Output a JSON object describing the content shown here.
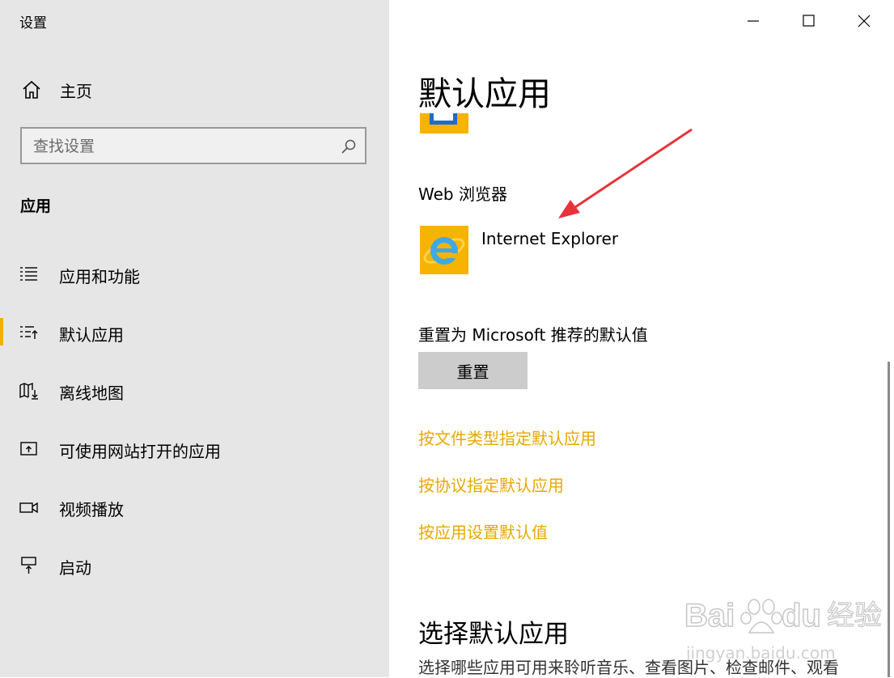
{
  "window": {
    "title": "设置"
  },
  "sidebar": {
    "home_label": "主页",
    "search_placeholder": "查找设置",
    "section": "应用",
    "items": [
      {
        "label": "应用和功能",
        "icon": "list-icon"
      },
      {
        "label": "默认应用",
        "icon": "default-apps-icon",
        "active": true
      },
      {
        "label": "离线地图",
        "icon": "map-download-icon"
      },
      {
        "label": "可使用网站打开的应用",
        "icon": "web-app-icon"
      },
      {
        "label": "视频播放",
        "icon": "video-icon"
      },
      {
        "label": "启动",
        "icon": "startup-icon"
      }
    ]
  },
  "main": {
    "title": "默认应用",
    "browser_label": "Web 浏览器",
    "browser_app": "Internet Explorer",
    "reset_label": "重置为 Microsoft 推荐的默认值",
    "reset_button": "重置",
    "links": [
      "按文件类型指定默认应用",
      "按协议指定默认应用",
      "按应用设置默认值"
    ],
    "choose_title": "选择默认应用",
    "choose_desc": "选择哪些应用可用来聆听音乐、查看图片、检查邮件、观看"
  },
  "watermark": {
    "text": "Baidu经验",
    "sub": "jingyan.baidu.com"
  },
  "colors": {
    "accent": "#f4b000",
    "link": "#e8a800",
    "sidebar_bg": "#e6e6e6",
    "arrow": "#e8333a"
  }
}
